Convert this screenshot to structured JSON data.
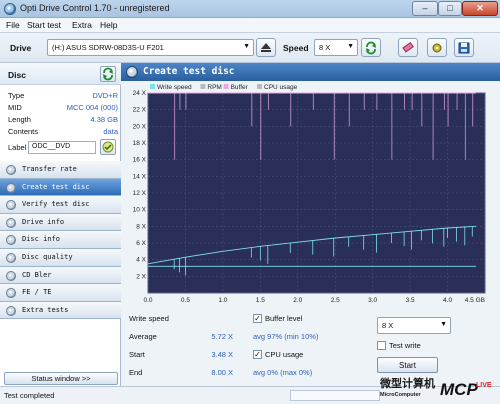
{
  "window": {
    "title": "Opti Drive Control 1.70 - unregistered",
    "min": "–",
    "max": "□",
    "close": "✕"
  },
  "menu": [
    "File",
    "Start test",
    "Extra",
    "Help"
  ],
  "toolbar": {
    "drive_label": "Drive",
    "drive_value": "(H:)  ASUS SDRW-08D3S-U F201",
    "speed_label": "Speed",
    "speed_value": "8 X"
  },
  "disc": {
    "title": "Disc",
    "rows": [
      {
        "key": "Type",
        "value": "DVD+R"
      },
      {
        "key": "MID",
        "value": "MCC 004 (000)"
      },
      {
        "key": "Length",
        "value": "4.38 GB"
      },
      {
        "key": "Contents",
        "value": "data"
      }
    ],
    "label_key": "Label",
    "label_value": "ODC__DVD"
  },
  "nav": [
    {
      "label": "Transfer rate",
      "active": false
    },
    {
      "label": "Create test disc",
      "active": true
    },
    {
      "label": "Verify test disc",
      "active": false
    },
    {
      "label": "Drive info",
      "active": false
    },
    {
      "label": "Disc info",
      "active": false
    },
    {
      "label": "Disc quality",
      "active": false
    },
    {
      "label": "CD Bler",
      "active": false
    },
    {
      "label": "FE / TE",
      "active": false
    },
    {
      "label": "Extra tests",
      "active": false
    }
  ],
  "status_window_button": "Status window >>",
  "panel_title": "Create test disc",
  "chart_data": {
    "type": "line",
    "legend": [
      "Write speed",
      "RPM",
      "Buffer",
      "CPU usage"
    ],
    "x_ticks": [
      "0.0",
      "0.5",
      "1.0",
      "1.5",
      "2.0",
      "2.5",
      "3.0",
      "3.5",
      "4.0",
      "4.5 GB"
    ],
    "y_ticks": [
      "2 X",
      "4 X",
      "6 X",
      "8 X",
      "10 X",
      "12 X",
      "14 X",
      "16 X",
      "18 X",
      "20 X",
      "22 X",
      "24 X"
    ],
    "xlim": [
      0,
      4.5
    ],
    "ylim": [
      0,
      24
    ],
    "grid": true,
    "series": [
      {
        "name": "Write speed",
        "color": "#7fe0e6",
        "x": [
          0.0,
          0.5,
          1.0,
          1.5,
          2.0,
          2.5,
          3.0,
          3.5,
          4.0,
          4.38
        ],
        "values": [
          3.5,
          4.3,
          5.0,
          5.6,
          6.1,
          6.6,
          7.0,
          7.4,
          7.8,
          8.0
        ]
      },
      {
        "name": "RPM",
        "color": "#7fe0e6",
        "x": [
          0.0,
          4.38
        ],
        "values": [
          3.2,
          3.2
        ]
      },
      {
        "name": "Buffer",
        "color": "#e6a8e0",
        "x": [
          0.0,
          0.5,
          1.5,
          2.4,
          3.1,
          3.5,
          4.0,
          4.38
        ],
        "values": [
          24,
          24,
          24,
          24,
          24,
          24,
          24,
          24
        ]
      }
    ],
    "dips": [
      0.35,
      0.42,
      0.5,
      1.38,
      1.5,
      1.6,
      1.9,
      2.2,
      2.48,
      2.68,
      2.88,
      3.05,
      3.25,
      3.42,
      3.52,
      3.65,
      3.8,
      3.95,
      4.0,
      4.12,
      4.23,
      4.33
    ]
  },
  "stats": {
    "write_speed_label": "Write speed",
    "average_label": "Average",
    "average_value": "5.72 X",
    "start_label": "Start",
    "start_value": "3.48 X",
    "end_label": "End",
    "end_value": "8.00 X",
    "buffer_label": "Buffer level",
    "buffer_avg": "avg 97% (min 10%)",
    "cpu_label": "CPU usage",
    "cpu_avg": "avg 0% (max 0%)",
    "speed_select": "8 X",
    "test_write_label": "Test write",
    "start_button": "Start"
  },
  "status_text": "Test completed",
  "watermark": "微型计算机 MicroComputer MCPLIVE"
}
